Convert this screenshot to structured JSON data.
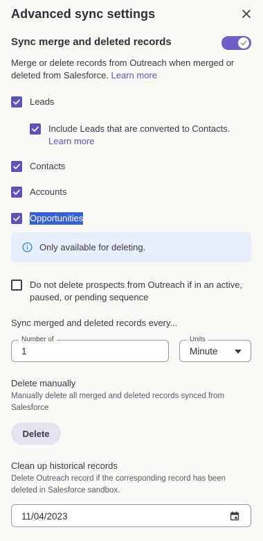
{
  "header": {
    "title": "Advanced sync settings"
  },
  "sync": {
    "title": "Sync merge and deleted records",
    "toggle_on": true,
    "description": "Merge or delete records from Outreach when merged or deleted from Salesforce.",
    "learn_more": "Learn more"
  },
  "options": {
    "leads": {
      "label": "Leads",
      "checked": true
    },
    "converted": {
      "label": "Include Leads that are converted to Contacts.",
      "link": "Learn more",
      "checked": true
    },
    "contacts": {
      "label": "Contacts",
      "checked": true
    },
    "accounts": {
      "label": "Accounts",
      "checked": true
    },
    "opportunities": {
      "label": "Opportunities",
      "checked": true
    }
  },
  "info": {
    "text": "Only available for deleting."
  },
  "no_delete": {
    "label": "Do not delete prospects from Outreach if in an active, paused, or pending sequence",
    "checked": false
  },
  "frequency": {
    "label": "Sync merged and deleted records every...",
    "number_label": "Number of",
    "number_value": "1",
    "units_label": "Units",
    "units_value": "Minute"
  },
  "manual": {
    "title": "Delete manually",
    "description": "Manually delete all merged and deleted records synced from Salesforce",
    "button": "Delete"
  },
  "cleanup": {
    "title": "Clean up historical records",
    "description": "Delete Outreach record if the corresponding record has been deleted in Salesforce sandbox.",
    "date": "11/04/2023"
  },
  "colors": {
    "accent": "#5d53b8",
    "toggle": "#6e62c9",
    "info_bg": "#e6eefb",
    "link": "#5a4fcf"
  }
}
